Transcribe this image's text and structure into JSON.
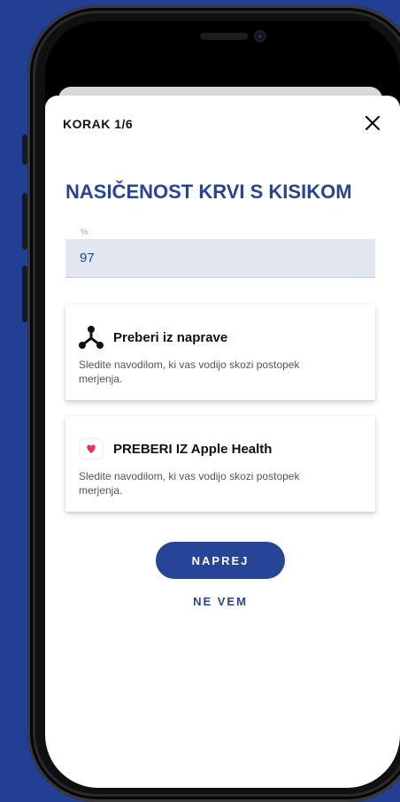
{
  "modal": {
    "step_label": "KORAK 1/6",
    "title": "NASIČENOST KRVI S KISIKOM"
  },
  "field": {
    "unit_label": "%",
    "value": "97"
  },
  "options": [
    {
      "icon": "network-nodes-icon",
      "title": "Preberi iz naprave",
      "description": "Sledite navodilom, ki vas vodijo skozi postopek merjenja."
    },
    {
      "icon": "apple-health-heart-icon",
      "title": "PREBERI IZ Apple Health",
      "description": "Sledite navodilom, ki vas vodijo skozi postopek merjenja."
    }
  ],
  "actions": {
    "next_label": "NAPREJ",
    "dont_know_label": "NE VEM"
  },
  "colors": {
    "background": "#233f94",
    "accent": "#264596",
    "input_bg": "#e2e6f0",
    "heart": "#e8334a"
  }
}
